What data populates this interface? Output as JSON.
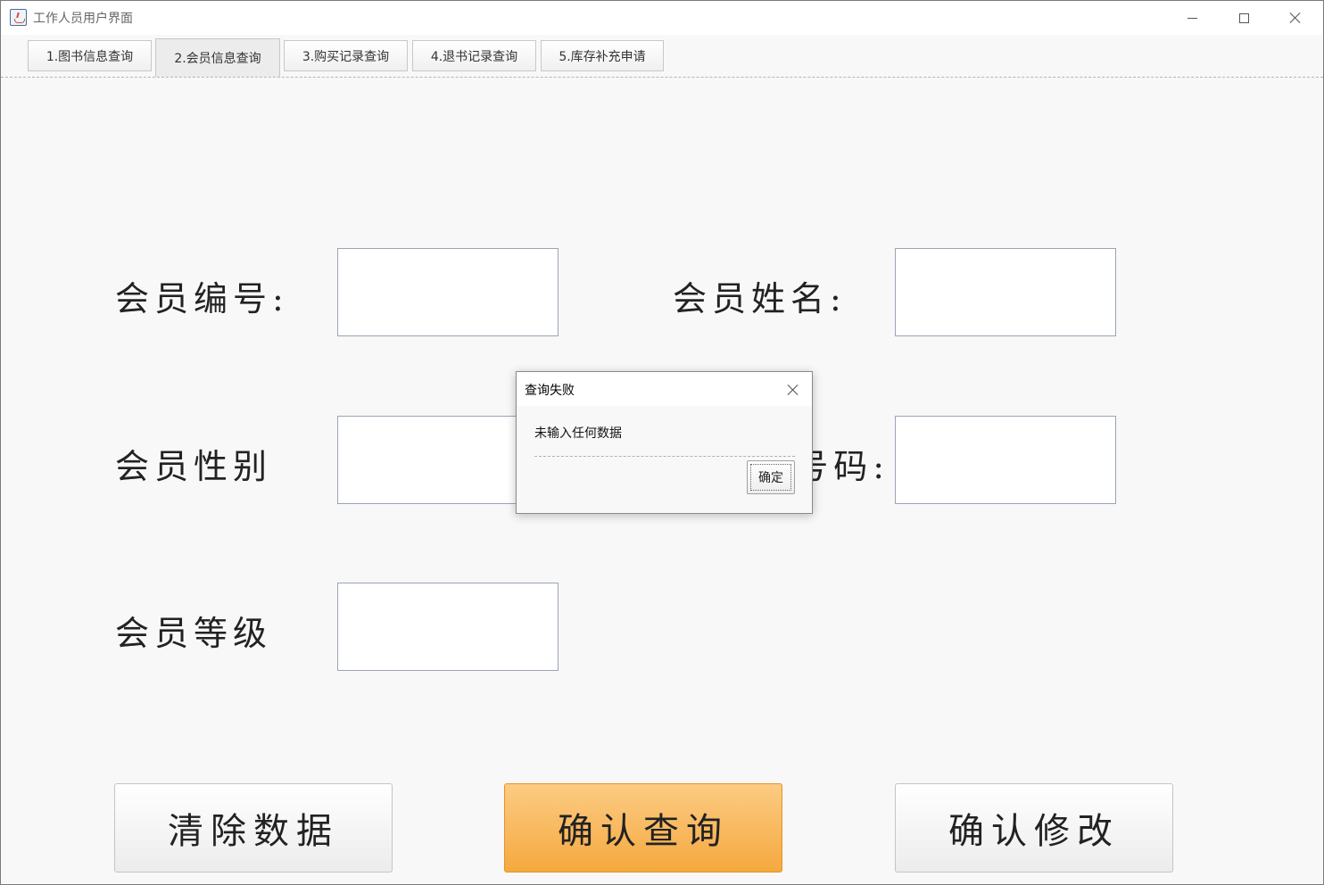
{
  "window": {
    "title": "工作人员用户界面",
    "controls": {
      "minimize": "minimize-icon",
      "maximize": "maximize-icon",
      "close": "close-icon"
    }
  },
  "tabs": [
    {
      "label": "1.图书信息查询",
      "selected": false
    },
    {
      "label": "2.会员信息查询",
      "selected": true
    },
    {
      "label": "3.购买记录查询",
      "selected": false
    },
    {
      "label": "4.退书记录查询",
      "selected": false
    },
    {
      "label": "5.库存补充申请",
      "selected": false
    }
  ],
  "form": {
    "member_id_label": "会员编号:",
    "member_name_label": "会员姓名:",
    "member_gender_label": "会员性别",
    "phone_label_visible": "号码:",
    "member_level_label": "会员等级",
    "member_id_value": "",
    "member_name_value": "",
    "member_gender_value": "",
    "phone_value": "",
    "member_level_value": ""
  },
  "actions": {
    "clear": "清除数据",
    "query": "确认查询",
    "modify": "确认修改"
  },
  "dialog": {
    "title": "查询失败",
    "message": "未输入任何数据",
    "ok": "确定"
  },
  "colors": {
    "primary_button": "#f7b557",
    "window_background": "#f8f8f8"
  }
}
